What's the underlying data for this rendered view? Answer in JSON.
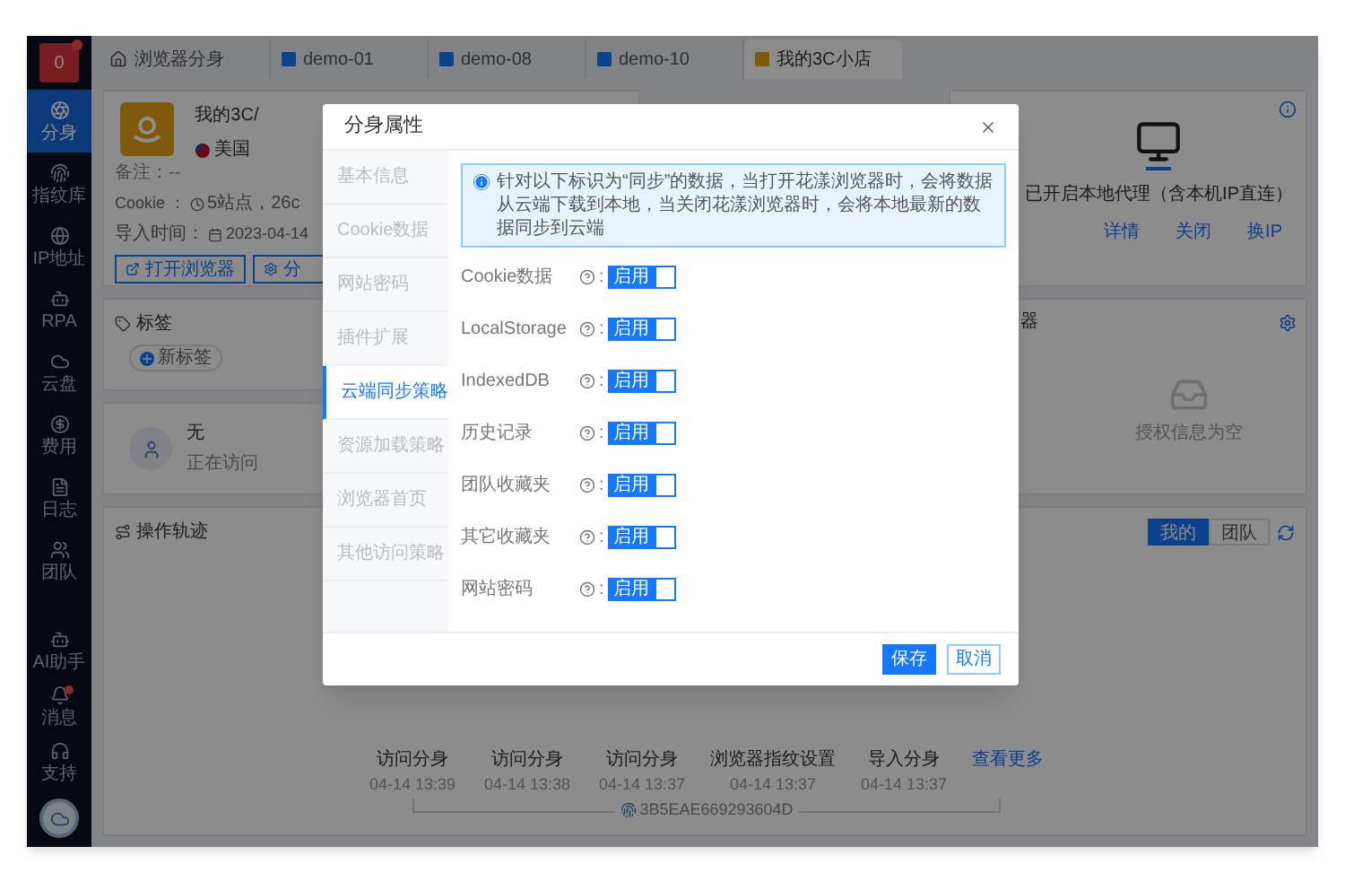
{
  "sidebar": {
    "logo_badge": "0",
    "items": [
      {
        "label": "分身",
        "selected": true
      },
      {
        "label": "指纹库",
        "selected": false
      },
      {
        "label": "IP地址",
        "selected": false
      },
      {
        "label": "RPA",
        "selected": false
      },
      {
        "label": "云盘",
        "selected": false
      },
      {
        "label": "费用",
        "selected": false
      },
      {
        "label": "日志",
        "selected": false
      },
      {
        "label": "团队",
        "selected": false
      }
    ],
    "bottom_items": [
      {
        "label": "AI助手",
        "badge": false
      },
      {
        "label": "消息",
        "badge": true
      },
      {
        "label": "支持",
        "badge": false
      }
    ]
  },
  "tabs": [
    {
      "kind": "home",
      "label": "浏览器分身",
      "selected": false
    },
    {
      "kind": "profile",
      "label": "demo-01",
      "selected": false
    },
    {
      "kind": "profile",
      "label": "demo-08",
      "selected": false
    },
    {
      "kind": "profile",
      "label": "demo-10",
      "selected": false
    },
    {
      "kind": "profile",
      "label": "我的3C小店",
      "selected": true
    }
  ],
  "profile_card": {
    "name": "我的3C/",
    "country": "美国",
    "note": "备注：--",
    "cookie_label": "Cookie ：",
    "cookie_value": "5站点，26c",
    "import_label": "导入时间：",
    "import_value": "2023-04-14",
    "buttons": [
      "打开浏览器",
      "分"
    ]
  },
  "tags_card": {
    "title": "标签",
    "add_button": "新标签"
  },
  "visitor_card": {
    "name": "无",
    "status": "正在访问"
  },
  "proxy_card": {
    "status": "已开启本地代理（含本机IP直连）",
    "links": [
      "详情",
      "关闭",
      "换IP"
    ]
  },
  "auth_card": {
    "title": "器",
    "empty_text": "授权信息为空"
  },
  "activity_card": {
    "title": "操作轨迹",
    "scope_tabs": [
      {
        "label": "我的",
        "selected": true
      },
      {
        "label": "团队",
        "selected": false
      }
    ],
    "events": [
      {
        "action": "访问分身",
        "time": "04-14 13:39"
      },
      {
        "action": "访问分身",
        "time": "04-14 13:38"
      },
      {
        "action": "访问分身",
        "time": "04-14 13:37"
      },
      {
        "action": "浏览器指纹设置",
        "time": "04-14 13:37"
      },
      {
        "action": "导入分身",
        "time": "04-14 13:37"
      }
    ],
    "more_link": "查看更多",
    "profile_id": "3B5EAE669293604D"
  },
  "dialog": {
    "title": "分身属性",
    "nav": [
      {
        "label": "基本信息",
        "selected": false
      },
      {
        "label": "Cookie数据",
        "selected": false
      },
      {
        "label": "网站密码",
        "selected": false
      },
      {
        "label": "插件扩展",
        "selected": false
      },
      {
        "label": "云端同步策略",
        "selected": true
      },
      {
        "label": "资源加载策略",
        "selected": false
      },
      {
        "label": "浏览器首页",
        "selected": false
      },
      {
        "label": "其他访问策略",
        "selected": false
      }
    ],
    "notice": "针对以下标识为“同步”的数据，当打开花漾浏览器时，会将数据从云端下载到本地，当关闭花漾浏览器时，会将本地最新的数据同步到云端",
    "rows": [
      {
        "label": "Cookie数据",
        "colon": ":",
        "switch_text": "启用",
        "on": true
      },
      {
        "label": "LocalStorage",
        "colon": ":",
        "switch_text": "启用",
        "on": true
      },
      {
        "label": "IndexedDB",
        "colon": ":",
        "switch_text": "启用",
        "on": true
      },
      {
        "label": "历史记录",
        "colon": ":",
        "switch_text": "启用",
        "on": true
      },
      {
        "label": "团队收藏夹",
        "colon": ":",
        "switch_text": "启用",
        "on": true
      },
      {
        "label": "其它收藏夹",
        "colon": ":",
        "switch_text": "启用",
        "on": true
      },
      {
        "label": "网站密码",
        "colon": ":",
        "switch_text": "启用",
        "on": true
      }
    ],
    "buttons": [
      {
        "label": "保存",
        "kind": "primary"
      },
      {
        "label": "取消",
        "kind": "default"
      }
    ]
  }
}
